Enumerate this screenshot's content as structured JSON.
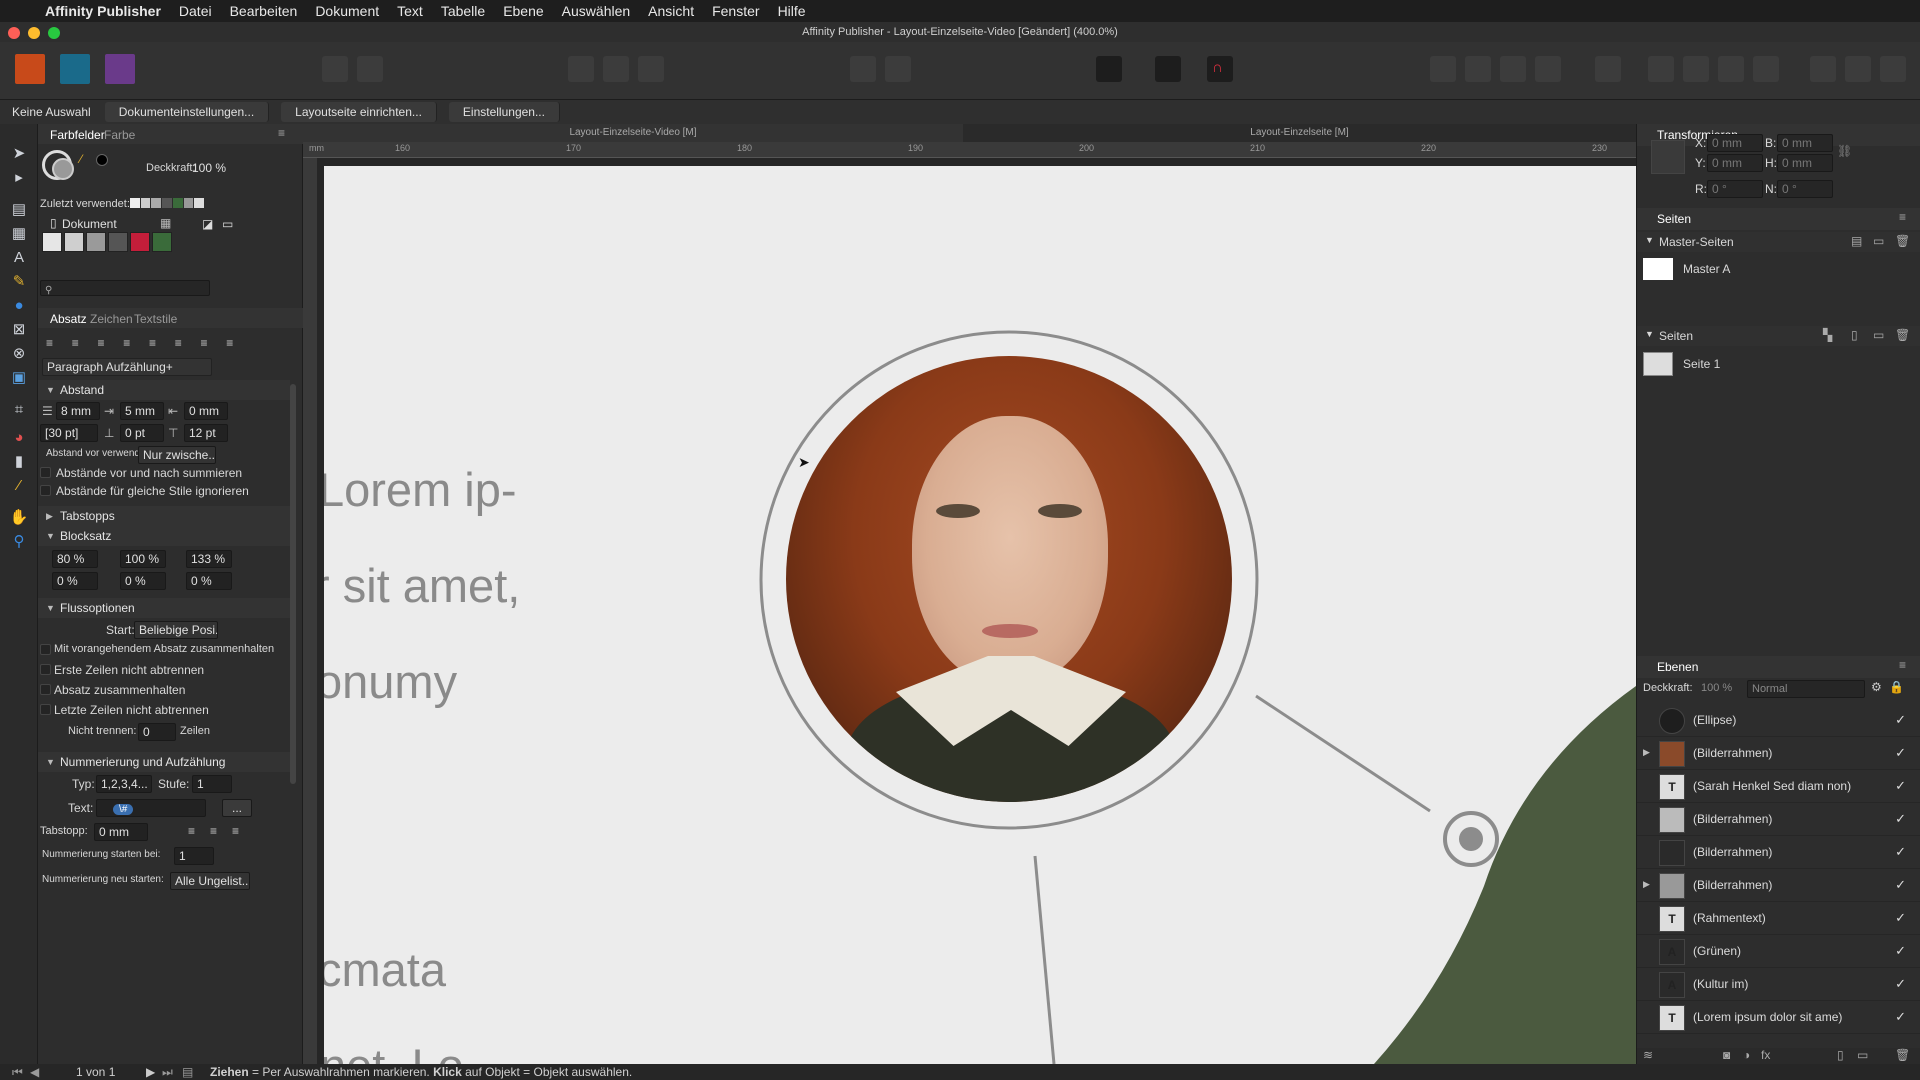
{
  "menubar": {
    "app_name": "Affinity Publisher",
    "items": [
      "Datei",
      "Bearbeiten",
      "Dokument",
      "Text",
      "Tabelle",
      "Ebene",
      "Auswählen",
      "Ansicht",
      "Fenster",
      "Hilfe"
    ]
  },
  "window": {
    "title": "Affinity Publisher - Layout-Einzelseite-Video [Geändert] (400.0%)"
  },
  "context_toolbar": {
    "selection": "Keine Auswahl",
    "buttons": [
      "Dokumenteinstellungen...",
      "Layoutseite einrichten...",
      "Einstellungen..."
    ]
  },
  "doc_tabs": [
    "Layout-Einzelseite-Video [M]",
    "Layout-Einzelseite [M]"
  ],
  "ruler": {
    "ticks": [
      "160",
      "170",
      "180",
      "190",
      "200",
      "210",
      "220",
      "230"
    ],
    "unit_label": "mm"
  },
  "swatches": {
    "tabs": [
      "Farbfelder",
      "Farbe"
    ],
    "opacity_label": "Deckkraft:",
    "opacity_value": "100 %",
    "recent_label": "Zuletzt verwendet:",
    "palette": "Dokument",
    "palette_colors": [
      "#e6e6e6",
      "#cfcfcf",
      "#9a9a9a",
      "#555555",
      "#c41e3a",
      "#3a6b3a"
    ],
    "search_placeholder": ""
  },
  "paragraph": {
    "tabs": [
      "Absatz",
      "Zeichen",
      "Textstile"
    ],
    "style": "Paragraph Aufzählung+",
    "spacing_title": "Abstand",
    "left_indent": "8 mm",
    "first_indent": "5 mm",
    "right_indent": "0 mm",
    "leading": "[30 pt]",
    "space_before": "0 pt",
    "space_after": "12 pt",
    "use_before_label": "Abstand vor verwenden:",
    "use_before_value": "Nur zwische...",
    "cb_sum": "Abstände vor und nach summieren",
    "cb_ignore": "Abstände für gleiche Stile ignorieren",
    "tabstops_title": "Tabstopps",
    "justify_title": "Blocksatz",
    "word_min": "80 %",
    "word_desired": "100 %",
    "word_max": "133 %",
    "letter_min": "0 %",
    "letter_desired": "0 %",
    "letter_max": "0 %",
    "flow_title": "Flussoptionen",
    "start_label": "Start:",
    "start_value": "Beliebige Posi...",
    "cb_keep_prev": "Mit vorangehendem Absatz zusammenhalten",
    "cb_first_lines": "Erste Zeilen nicht abtrennen",
    "cb_keep_together": "Absatz zusammenhalten",
    "cb_last_lines": "Letzte Zeilen nicht abtrennen",
    "no_break_label": "Nicht trennen:",
    "no_break_value": "0",
    "no_break_unit": "Zeilen",
    "numbering_title": "Nummerierung und Aufzählung",
    "type_label": "Typ:",
    "type_value": "1,2,3,4...",
    "level_label": "Stufe:",
    "level_value": "1",
    "text_label": "Text:",
    "text_token": "\\#",
    "text_ellipsis": "...",
    "tabstop_label": "Tabstopp:",
    "tabstop_value": "0 mm",
    "start_at_label": "Nummerierung starten bei:",
    "start_at_value": "1",
    "restart_label": "Nummerierung neu starten:",
    "restart_value": "Alle Ungelist..."
  },
  "canvas": {
    "text_lines": [
      "Lorem ip-",
      "r sit amet,",
      "onumy",
      "cmata",
      "net. Lo"
    ]
  },
  "transform": {
    "title": "Transformieren",
    "x_label": "X:",
    "x_value": "0 mm",
    "y_label": "Y:",
    "y_value": "0 mm",
    "w_label": "B:",
    "w_value": "0 mm",
    "h_label": "H:",
    "h_value": "0 mm",
    "r_label": "R:",
    "r_value": "0 °",
    "s_label": "N:",
    "s_value": "0 °"
  },
  "pages": {
    "title": "Seiten",
    "masters_title": "Master-Seiten",
    "master_item": "Master A",
    "pages_title": "Seiten",
    "page_item": "Seite 1"
  },
  "layers": {
    "title": "Ebenen",
    "opacity_label": "Deckkraft:",
    "opacity_value": "100 %",
    "blend_mode": "Normal",
    "items": [
      {
        "name": "(Ellipse)",
        "check": "✓"
      },
      {
        "name": "(Bilderrahmen)",
        "check": "✓"
      },
      {
        "name": "(Sarah Henkel Sed diam non)",
        "check": "✓"
      },
      {
        "name": "(Bilderrahmen)",
        "check": "✓"
      },
      {
        "name": "(Bilderrahmen)",
        "check": "✓"
      },
      {
        "name": "(Bilderrahmen)",
        "check": "✓"
      },
      {
        "name": "(Rahmentext)",
        "check": "✓"
      },
      {
        "name": "(Grünen)",
        "check": "✓"
      },
      {
        "name": "(Kultur im)",
        "check": "✓"
      },
      {
        "name": "(Lorem ipsum dolor sit ame)",
        "check": "✓"
      }
    ]
  },
  "status": {
    "page_indicator": "1 von 1",
    "hint_bold1": "Ziehen",
    "hint_text1": " = Per Auswahlrahmen markieren. ",
    "hint_bold2": "Klick",
    "hint_text2": " auf Objekt = Objekt auswählen."
  }
}
